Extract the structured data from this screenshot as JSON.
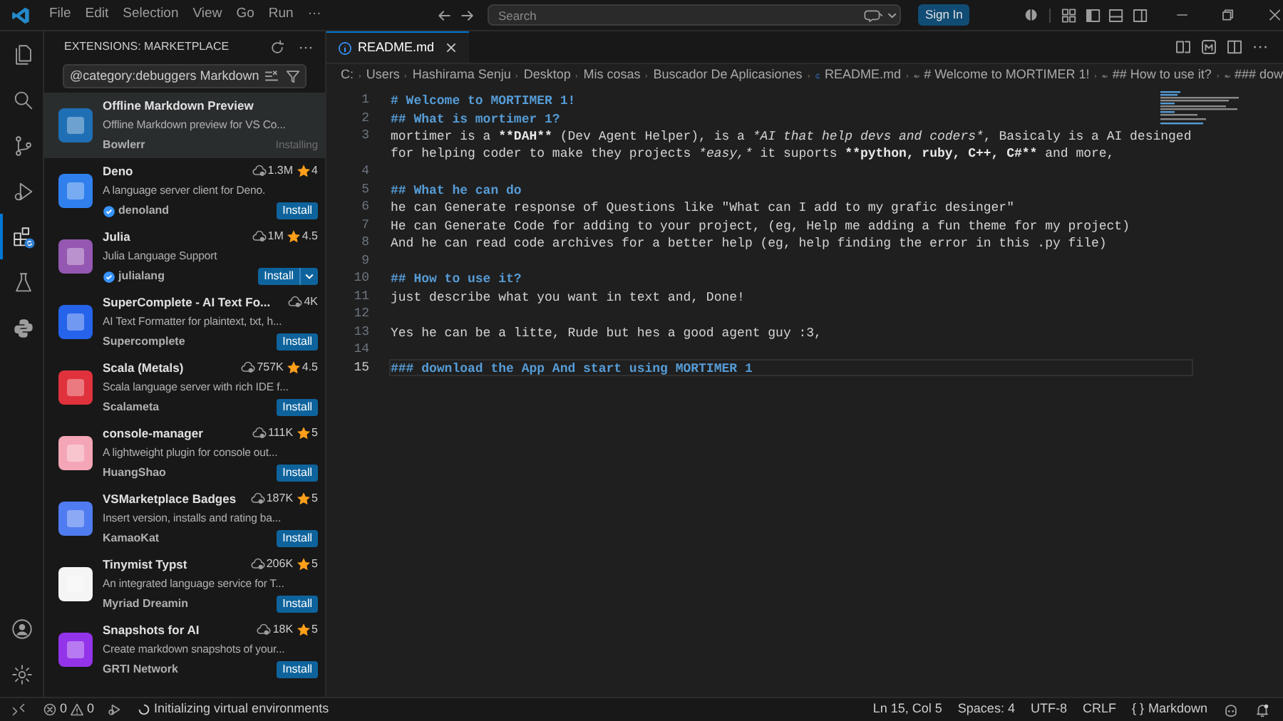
{
  "title_bar": {
    "menu": [
      "File",
      "Edit",
      "Selection",
      "View",
      "Go",
      "Run",
      "···"
    ],
    "search_placeholder": "Search",
    "sign_in": "Sign In"
  },
  "activity_bar": {
    "items": [
      {
        "kind": "files",
        "selected": false
      },
      {
        "kind": "search",
        "selected": false
      },
      {
        "kind": "source-control",
        "selected": false
      },
      {
        "kind": "run",
        "selected": false
      },
      {
        "kind": "extensions",
        "selected": true
      },
      {
        "kind": "testing",
        "selected": false
      },
      {
        "kind": "python",
        "selected": false
      }
    ]
  },
  "sidebar": {
    "title": "EXTENSIONS: MARKETPLACE",
    "search_value": "@category:debuggers Markdown",
    "extensions": [
      {
        "name": "Offline Markdown Preview",
        "description": "Offline Markdown preview for VS Co...",
        "publisher": "Bowlerr",
        "verified": false,
        "kind": "installing",
        "status": "Installing",
        "selected": true,
        "color": "#1f6fb5"
      },
      {
        "name": "Deno",
        "description": "A language server client for Deno.",
        "publisher": "denoland",
        "verified": true,
        "downloads": "1.3M",
        "rating": "4",
        "kind": "install",
        "button": "Install",
        "selected": false,
        "color": "#2f80ed"
      },
      {
        "name": "Julia",
        "description": "Julia Language Support",
        "publisher": "julialang",
        "verified": true,
        "downloads": "1M",
        "rating": "4.5",
        "kind": "install-menu",
        "button": "Install",
        "selected": false,
        "color": "#9558b2"
      },
      {
        "name": "SuperComplete - AI Text Fo...",
        "description": "AI Text Formatter for plaintext, txt, h...",
        "publisher": "Supercomplete",
        "verified": false,
        "downloads": "4K",
        "kind": "install",
        "button": "Install",
        "selected": false,
        "color": "#2563eb"
      },
      {
        "name": "Scala (Metals)",
        "description": "Scala language server with rich IDE f...",
        "publisher": "Scalameta",
        "verified": false,
        "downloads": "757K",
        "rating": "4.5",
        "kind": "install",
        "button": "Install",
        "selected": false,
        "color": "#e0323c"
      },
      {
        "name": "console-manager",
        "description": "A lightweight plugin for console out...",
        "publisher": "HuangShao",
        "verified": false,
        "downloads": "111K",
        "rating": "5",
        "kind": "install",
        "button": "Install",
        "selected": false,
        "color": "#f4a6b6"
      },
      {
        "name": "VSMarketplace Badges",
        "description": "Insert version, installs and rating ba...",
        "publisher": "KamaoKat",
        "verified": false,
        "downloads": "187K",
        "rating": "5",
        "kind": "install",
        "button": "Install",
        "selected": false,
        "color": "#4f7cf0"
      },
      {
        "name": "Tinymist Typst",
        "description": "An integrated language service for T...",
        "publisher": "Myriad Dreamin",
        "verified": false,
        "downloads": "206K",
        "rating": "5",
        "kind": "install",
        "button": "Install",
        "selected": false,
        "color": "#f5f5f5"
      },
      {
        "name": "Snapshots for AI",
        "description": "Create markdown snapshots of your...",
        "publisher": "GRTI Network",
        "verified": false,
        "downloads": "18K",
        "rating": "5",
        "kind": "install",
        "button": "Install",
        "selected": false,
        "color": "#9333ea"
      }
    ]
  },
  "editor": {
    "tab": {
      "label": "README.md",
      "selected": true
    },
    "breadcrumbs": [
      "C:",
      "Users",
      "Hashirama Senju",
      "Desktop",
      "Mis cosas",
      "Buscador De Aplicasiones",
      "README.md",
      "# Welcome to MORTIMER 1!",
      "## How to use it?",
      "### dow"
    ],
    "lines": [
      {
        "number": "1",
        "kind": "heading",
        "segments": [
          {
            "text": "# Welcome to MORTIMER 1!",
            "kind": "plain"
          }
        ]
      },
      {
        "number": "2",
        "kind": "heading",
        "segments": [
          {
            "text": "## What is mortimer 1?",
            "kind": "plain"
          }
        ]
      },
      {
        "number": "3",
        "kind": "text",
        "segments": [
          {
            "text": "mortimer is a ",
            "kind": "plain"
          },
          {
            "text": "**DAH**",
            "kind": "bold"
          },
          {
            "text": " (Dev Agent Helper), is a ",
            "kind": "plain"
          },
          {
            "text": "*AI that help devs and coders*",
            "kind": "italic"
          },
          {
            "text": ", Basicaly is a AI desinged",
            "kind": "plain"
          }
        ],
        "continuation": [
          {
            "text": "for helping coder to make they projects ",
            "kind": "plain"
          },
          {
            "text": "*easy,*",
            "kind": "italic"
          },
          {
            "text": " it suports ",
            "kind": "plain"
          },
          {
            "text": "**python, ruby, C++, C#**",
            "kind": "bold"
          },
          {
            "text": " and more,",
            "kind": "plain"
          }
        ]
      },
      {
        "number": "4",
        "kind": "blank"
      },
      {
        "number": "5",
        "kind": "heading",
        "segments": [
          {
            "text": "## What he can do",
            "kind": "plain"
          }
        ]
      },
      {
        "number": "6",
        "kind": "text",
        "segments": [
          {
            "text": "he can Generate response of Questions like \"What can I add to my grafic desinger\"",
            "kind": "plain"
          }
        ]
      },
      {
        "number": "7",
        "kind": "text",
        "segments": [
          {
            "text": "He can Generate Code for adding to your project, (eg, Help me adding a fun theme for my project)",
            "kind": "plain"
          }
        ]
      },
      {
        "number": "8",
        "kind": "text",
        "segments": [
          {
            "text": "And he can read code archives for a better help (eg, help finding the error in this .py file)",
            "kind": "plain"
          }
        ]
      },
      {
        "number": "9",
        "kind": "blank"
      },
      {
        "number": "10",
        "kind": "heading",
        "segments": [
          {
            "text": "## How to use it?",
            "kind": "plain"
          }
        ]
      },
      {
        "number": "11",
        "kind": "text",
        "segments": [
          {
            "text": "just describe what you want in text and, Done!",
            "kind": "plain"
          }
        ]
      },
      {
        "number": "12",
        "kind": "blank"
      },
      {
        "number": "13",
        "kind": "text",
        "segments": [
          {
            "text": "Yes he can be a litte, Rude but hes a good agent guy :3,",
            "kind": "plain"
          }
        ]
      },
      {
        "number": "14",
        "kind": "blank"
      },
      {
        "number": "15",
        "kind": "heading",
        "current": true,
        "segments": [
          {
            "text": "### download the App And start using MORTIMER 1",
            "kind": "plain"
          }
        ]
      }
    ]
  },
  "status_bar": {
    "errors": "0",
    "warnings": "0",
    "message": "Initializing virtual environments",
    "position": "Ln 15, Col 5",
    "indent": "Spaces: 4",
    "encoding": "UTF-8",
    "eol": "CRLF",
    "language_icon": "{ }",
    "language": "Markdown"
  }
}
